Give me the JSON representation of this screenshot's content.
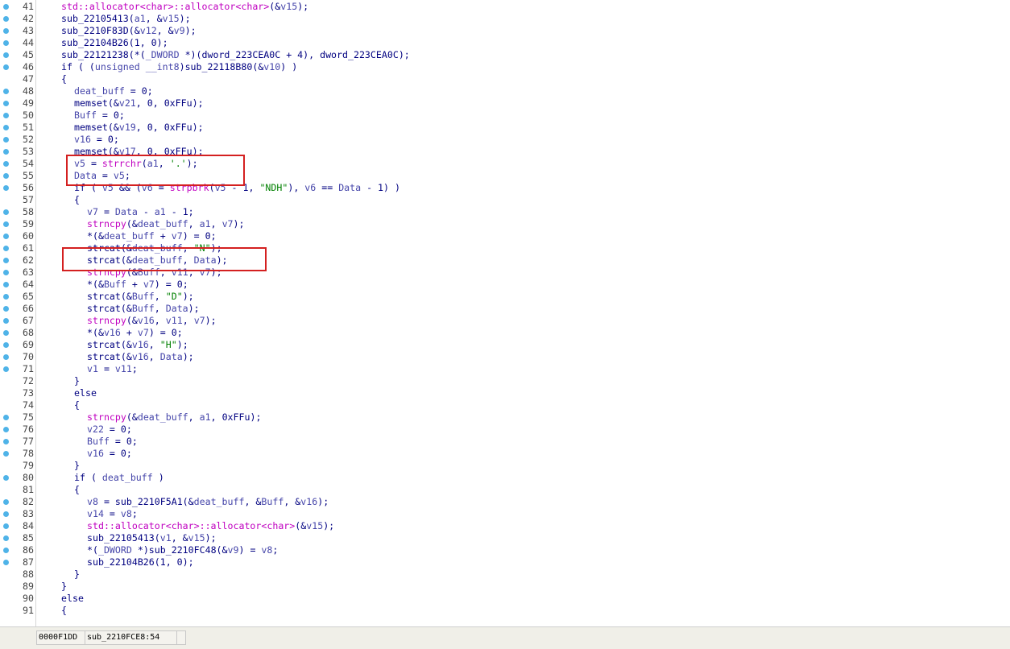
{
  "lines": [
    {
      "n": "41",
      "dot": true,
      "indent": 2,
      "tokens": [
        [
          "f",
          "std::allocator<char>::allocator<char>"
        ],
        [
          "n",
          "(&"
        ],
        [
          "v",
          "v15"
        ],
        [
          "n",
          ");"
        ]
      ]
    },
    {
      "n": "42",
      "dot": true,
      "indent": 2,
      "tokens": [
        [
          "n",
          "sub_22105413("
        ],
        [
          "v",
          "a1"
        ],
        [
          "n",
          ", &"
        ],
        [
          "v",
          "v15"
        ],
        [
          "n",
          ");"
        ]
      ]
    },
    {
      "n": "43",
      "dot": true,
      "indent": 2,
      "tokens": [
        [
          "n",
          "sub_2210F83D(&"
        ],
        [
          "v",
          "v12"
        ],
        [
          "n",
          ", &"
        ],
        [
          "v",
          "v9"
        ],
        [
          "n",
          ");"
        ]
      ]
    },
    {
      "n": "44",
      "dot": true,
      "indent": 2,
      "tokens": [
        [
          "n",
          "sub_22104B26(1, 0);"
        ]
      ]
    },
    {
      "n": "45",
      "dot": true,
      "indent": 2,
      "tokens": [
        [
          "n",
          "sub_22121238(*("
        ],
        [
          "v",
          "_DWORD"
        ],
        [
          "n",
          " *)(dword_223CEA0C + 4), dword_223CEA0C);"
        ]
      ]
    },
    {
      "n": "46",
      "dot": true,
      "indent": 2,
      "tokens": [
        [
          "k",
          "if"
        ],
        [
          "n",
          " ( ("
        ],
        [
          "v",
          "unsigned __int8"
        ],
        [
          "n",
          ")sub_22118B80(&"
        ],
        [
          "v",
          "v10"
        ],
        [
          "n",
          ") )"
        ]
      ]
    },
    {
      "n": "47",
      "dot": false,
      "indent": 2,
      "tokens": [
        [
          "n",
          "{"
        ]
      ]
    },
    {
      "n": "48",
      "dot": true,
      "indent": 4,
      "tokens": [
        [
          "v",
          "deat_buff"
        ],
        [
          "n",
          " = 0;"
        ]
      ]
    },
    {
      "n": "49",
      "dot": true,
      "indent": 4,
      "tokens": [
        [
          "n",
          "memset(&"
        ],
        [
          "v",
          "v21"
        ],
        [
          "n",
          ", 0, 0xFFu);"
        ]
      ]
    },
    {
      "n": "50",
      "dot": true,
      "indent": 4,
      "tokens": [
        [
          "v",
          "Buff"
        ],
        [
          "n",
          " = 0;"
        ]
      ]
    },
    {
      "n": "51",
      "dot": true,
      "indent": 4,
      "tokens": [
        [
          "n",
          "memset(&"
        ],
        [
          "v",
          "v19"
        ],
        [
          "n",
          ", 0, 0xFFu);"
        ]
      ]
    },
    {
      "n": "52",
      "dot": true,
      "indent": 4,
      "tokens": [
        [
          "v",
          "v16"
        ],
        [
          "n",
          " = 0;"
        ]
      ]
    },
    {
      "n": "53",
      "dot": true,
      "indent": 4,
      "tokens": [
        [
          "n",
          "memset(&"
        ],
        [
          "v",
          "v17"
        ],
        [
          "n",
          ", 0, 0xFFu);"
        ]
      ]
    },
    {
      "n": "54",
      "dot": true,
      "indent": 4,
      "tokens": [
        [
          "v",
          "v5"
        ],
        [
          "n",
          " = "
        ],
        [
          "f",
          "strrchr"
        ],
        [
          "n",
          "("
        ],
        [
          "v",
          "a1"
        ],
        [
          "n",
          ", "
        ],
        [
          "s",
          "'.'"
        ],
        [
          "n",
          ");"
        ]
      ]
    },
    {
      "n": "55",
      "dot": true,
      "indent": 4,
      "tokens": [
        [
          "v",
          "Data"
        ],
        [
          "n",
          " = "
        ],
        [
          "v",
          "v5"
        ],
        [
          "n",
          ";"
        ]
      ]
    },
    {
      "n": "56",
      "dot": true,
      "indent": 4,
      "tokens": [
        [
          "k",
          "if"
        ],
        [
          "n",
          " ( "
        ],
        [
          "v",
          "v5"
        ],
        [
          "n",
          " && ("
        ],
        [
          "v",
          "v6"
        ],
        [
          "n",
          " = "
        ],
        [
          "f",
          "strpbrk"
        ],
        [
          "n",
          "("
        ],
        [
          "v",
          "v5"
        ],
        [
          "n",
          " - 1, "
        ],
        [
          "s",
          "\"NDH\""
        ],
        [
          "n",
          "), "
        ],
        [
          "v",
          "v6"
        ],
        [
          "n",
          " == "
        ],
        [
          "v",
          "Data"
        ],
        [
          "n",
          " - 1) )"
        ]
      ]
    },
    {
      "n": "57",
      "dot": false,
      "indent": 4,
      "tokens": [
        [
          "n",
          "{"
        ]
      ]
    },
    {
      "n": "58",
      "dot": true,
      "indent": 6,
      "tokens": [
        [
          "v",
          "v7"
        ],
        [
          "n",
          " = "
        ],
        [
          "v",
          "Data"
        ],
        [
          "n",
          " - "
        ],
        [
          "v",
          "a1"
        ],
        [
          "n",
          " - 1;"
        ]
      ]
    },
    {
      "n": "59",
      "dot": true,
      "indent": 6,
      "tokens": [
        [
          "f",
          "strncpy"
        ],
        [
          "n",
          "(&"
        ],
        [
          "v",
          "deat_buff"
        ],
        [
          "n",
          ", "
        ],
        [
          "v",
          "a1"
        ],
        [
          "n",
          ", "
        ],
        [
          "v",
          "v7"
        ],
        [
          "n",
          ");"
        ]
      ]
    },
    {
      "n": "60",
      "dot": true,
      "indent": 6,
      "tokens": [
        [
          "n",
          "*(&"
        ],
        [
          "v",
          "deat_buff"
        ],
        [
          "n",
          " + "
        ],
        [
          "v",
          "v7"
        ],
        [
          "n",
          ") = 0;"
        ]
      ]
    },
    {
      "n": "61",
      "dot": true,
      "indent": 6,
      "tokens": [
        [
          "n",
          "strcat(&"
        ],
        [
          "v",
          "deat_buff"
        ],
        [
          "n",
          ", "
        ],
        [
          "s",
          "\"N\""
        ],
        [
          "n",
          ");"
        ]
      ]
    },
    {
      "n": "62",
      "dot": true,
      "indent": 6,
      "tokens": [
        [
          "n",
          "strcat(&"
        ],
        [
          "v",
          "deat_buff"
        ],
        [
          "n",
          ", "
        ],
        [
          "v",
          "Data"
        ],
        [
          "n",
          ");"
        ]
      ]
    },
    {
      "n": "63",
      "dot": true,
      "indent": 6,
      "tokens": [
        [
          "f",
          "strncpy"
        ],
        [
          "n",
          "(&"
        ],
        [
          "v",
          "Buff"
        ],
        [
          "n",
          ", "
        ],
        [
          "v",
          "v11"
        ],
        [
          "n",
          ", "
        ],
        [
          "v",
          "v7"
        ],
        [
          "n",
          ");"
        ]
      ]
    },
    {
      "n": "64",
      "dot": true,
      "indent": 6,
      "tokens": [
        [
          "n",
          "*(&"
        ],
        [
          "v",
          "Buff"
        ],
        [
          "n",
          " + "
        ],
        [
          "v",
          "v7"
        ],
        [
          "n",
          ") = 0;"
        ]
      ]
    },
    {
      "n": "65",
      "dot": true,
      "indent": 6,
      "tokens": [
        [
          "n",
          "strcat(&"
        ],
        [
          "v",
          "Buff"
        ],
        [
          "n",
          ", "
        ],
        [
          "s",
          "\"D\""
        ],
        [
          "n",
          ");"
        ]
      ]
    },
    {
      "n": "66",
      "dot": true,
      "indent": 6,
      "tokens": [
        [
          "n",
          "strcat(&"
        ],
        [
          "v",
          "Buff"
        ],
        [
          "n",
          ", "
        ],
        [
          "v",
          "Data"
        ],
        [
          "n",
          ");"
        ]
      ]
    },
    {
      "n": "67",
      "dot": true,
      "indent": 6,
      "tokens": [
        [
          "f",
          "strncpy"
        ],
        [
          "n",
          "(&"
        ],
        [
          "v",
          "v16"
        ],
        [
          "n",
          ", "
        ],
        [
          "v",
          "v11"
        ],
        [
          "n",
          ", "
        ],
        [
          "v",
          "v7"
        ],
        [
          "n",
          ");"
        ]
      ]
    },
    {
      "n": "68",
      "dot": true,
      "indent": 6,
      "tokens": [
        [
          "n",
          "*(&"
        ],
        [
          "v",
          "v16"
        ],
        [
          "n",
          " + "
        ],
        [
          "v",
          "v7"
        ],
        [
          "n",
          ") = 0;"
        ]
      ]
    },
    {
      "n": "69",
      "dot": true,
      "indent": 6,
      "tokens": [
        [
          "n",
          "strcat(&"
        ],
        [
          "v",
          "v16"
        ],
        [
          "n",
          ", "
        ],
        [
          "s",
          "\"H\""
        ],
        [
          "n",
          ");"
        ]
      ]
    },
    {
      "n": "70",
      "dot": true,
      "indent": 6,
      "tokens": [
        [
          "n",
          "strcat(&"
        ],
        [
          "v",
          "v16"
        ],
        [
          "n",
          ", "
        ],
        [
          "v",
          "Data"
        ],
        [
          "n",
          ");"
        ]
      ]
    },
    {
      "n": "71",
      "dot": true,
      "indent": 6,
      "tokens": [
        [
          "v",
          "v1"
        ],
        [
          "n",
          " = "
        ],
        [
          "v",
          "v11"
        ],
        [
          "n",
          ";"
        ]
      ]
    },
    {
      "n": "72",
      "dot": false,
      "indent": 4,
      "tokens": [
        [
          "n",
          "}"
        ]
      ]
    },
    {
      "n": "73",
      "dot": false,
      "indent": 4,
      "tokens": [
        [
          "k",
          "else"
        ]
      ]
    },
    {
      "n": "74",
      "dot": false,
      "indent": 4,
      "tokens": [
        [
          "n",
          "{"
        ]
      ]
    },
    {
      "n": "75",
      "dot": true,
      "indent": 6,
      "tokens": [
        [
          "f",
          "strncpy"
        ],
        [
          "n",
          "(&"
        ],
        [
          "v",
          "deat_buff"
        ],
        [
          "n",
          ", "
        ],
        [
          "v",
          "a1"
        ],
        [
          "n",
          ", 0xFFu);"
        ]
      ]
    },
    {
      "n": "76",
      "dot": true,
      "indent": 6,
      "tokens": [
        [
          "v",
          "v22"
        ],
        [
          "n",
          " = 0;"
        ]
      ]
    },
    {
      "n": "77",
      "dot": true,
      "indent": 6,
      "tokens": [
        [
          "v",
          "Buff"
        ],
        [
          "n",
          " = 0;"
        ]
      ]
    },
    {
      "n": "78",
      "dot": true,
      "indent": 6,
      "tokens": [
        [
          "v",
          "v16"
        ],
        [
          "n",
          " = 0;"
        ]
      ]
    },
    {
      "n": "79",
      "dot": false,
      "indent": 4,
      "tokens": [
        [
          "n",
          "}"
        ]
      ]
    },
    {
      "n": "80",
      "dot": true,
      "indent": 4,
      "tokens": [
        [
          "k",
          "if"
        ],
        [
          "n",
          " ( "
        ],
        [
          "v",
          "deat_buff"
        ],
        [
          "n",
          " )"
        ]
      ]
    },
    {
      "n": "81",
      "dot": false,
      "indent": 4,
      "tokens": [
        [
          "n",
          "{"
        ]
      ]
    },
    {
      "n": "82",
      "dot": true,
      "indent": 6,
      "tokens": [
        [
          "v",
          "v8"
        ],
        [
          "n",
          " = sub_2210F5A1(&"
        ],
        [
          "v",
          "deat_buff"
        ],
        [
          "n",
          ", &"
        ],
        [
          "v",
          "Buff"
        ],
        [
          "n",
          ", &"
        ],
        [
          "v",
          "v16"
        ],
        [
          "n",
          ");"
        ]
      ]
    },
    {
      "n": "83",
      "dot": true,
      "indent": 6,
      "tokens": [
        [
          "v",
          "v14"
        ],
        [
          "n",
          " = "
        ],
        [
          "v",
          "v8"
        ],
        [
          "n",
          ";"
        ]
      ]
    },
    {
      "n": "84",
      "dot": true,
      "indent": 6,
      "tokens": [
        [
          "f",
          "std::allocator<char>::allocator<char>"
        ],
        [
          "n",
          "(&"
        ],
        [
          "v",
          "v15"
        ],
        [
          "n",
          ");"
        ]
      ]
    },
    {
      "n": "85",
      "dot": true,
      "indent": 6,
      "tokens": [
        [
          "n",
          "sub_22105413("
        ],
        [
          "v",
          "v1"
        ],
        [
          "n",
          ", &"
        ],
        [
          "v",
          "v15"
        ],
        [
          "n",
          ");"
        ]
      ]
    },
    {
      "n": "86",
      "dot": true,
      "indent": 6,
      "tokens": [
        [
          "n",
          "*("
        ],
        [
          "v",
          "_DWORD"
        ],
        [
          "n",
          " *)sub_2210FC48(&"
        ],
        [
          "v",
          "v9"
        ],
        [
          "n",
          ") = "
        ],
        [
          "v",
          "v8"
        ],
        [
          "n",
          ";"
        ]
      ]
    },
    {
      "n": "87",
      "dot": true,
      "indent": 6,
      "tokens": [
        [
          "n",
          "sub_22104B26(1, 0);"
        ]
      ]
    },
    {
      "n": "88",
      "dot": false,
      "indent": 4,
      "tokens": [
        [
          "n",
          "}"
        ]
      ]
    },
    {
      "n": "89",
      "dot": false,
      "indent": 2,
      "tokens": [
        [
          "n",
          "}"
        ]
      ]
    },
    {
      "n": "90",
      "dot": false,
      "indent": 2,
      "tokens": [
        [
          "k",
          "else"
        ]
      ]
    },
    {
      "n": "91",
      "dot": false,
      "indent": 2,
      "tokens": [
        [
          "n",
          "{"
        ]
      ]
    }
  ],
  "highlight_color": "#d42020",
  "status": {
    "address": "0000F1DD",
    "location": "sub_2210FCE8:54"
  }
}
